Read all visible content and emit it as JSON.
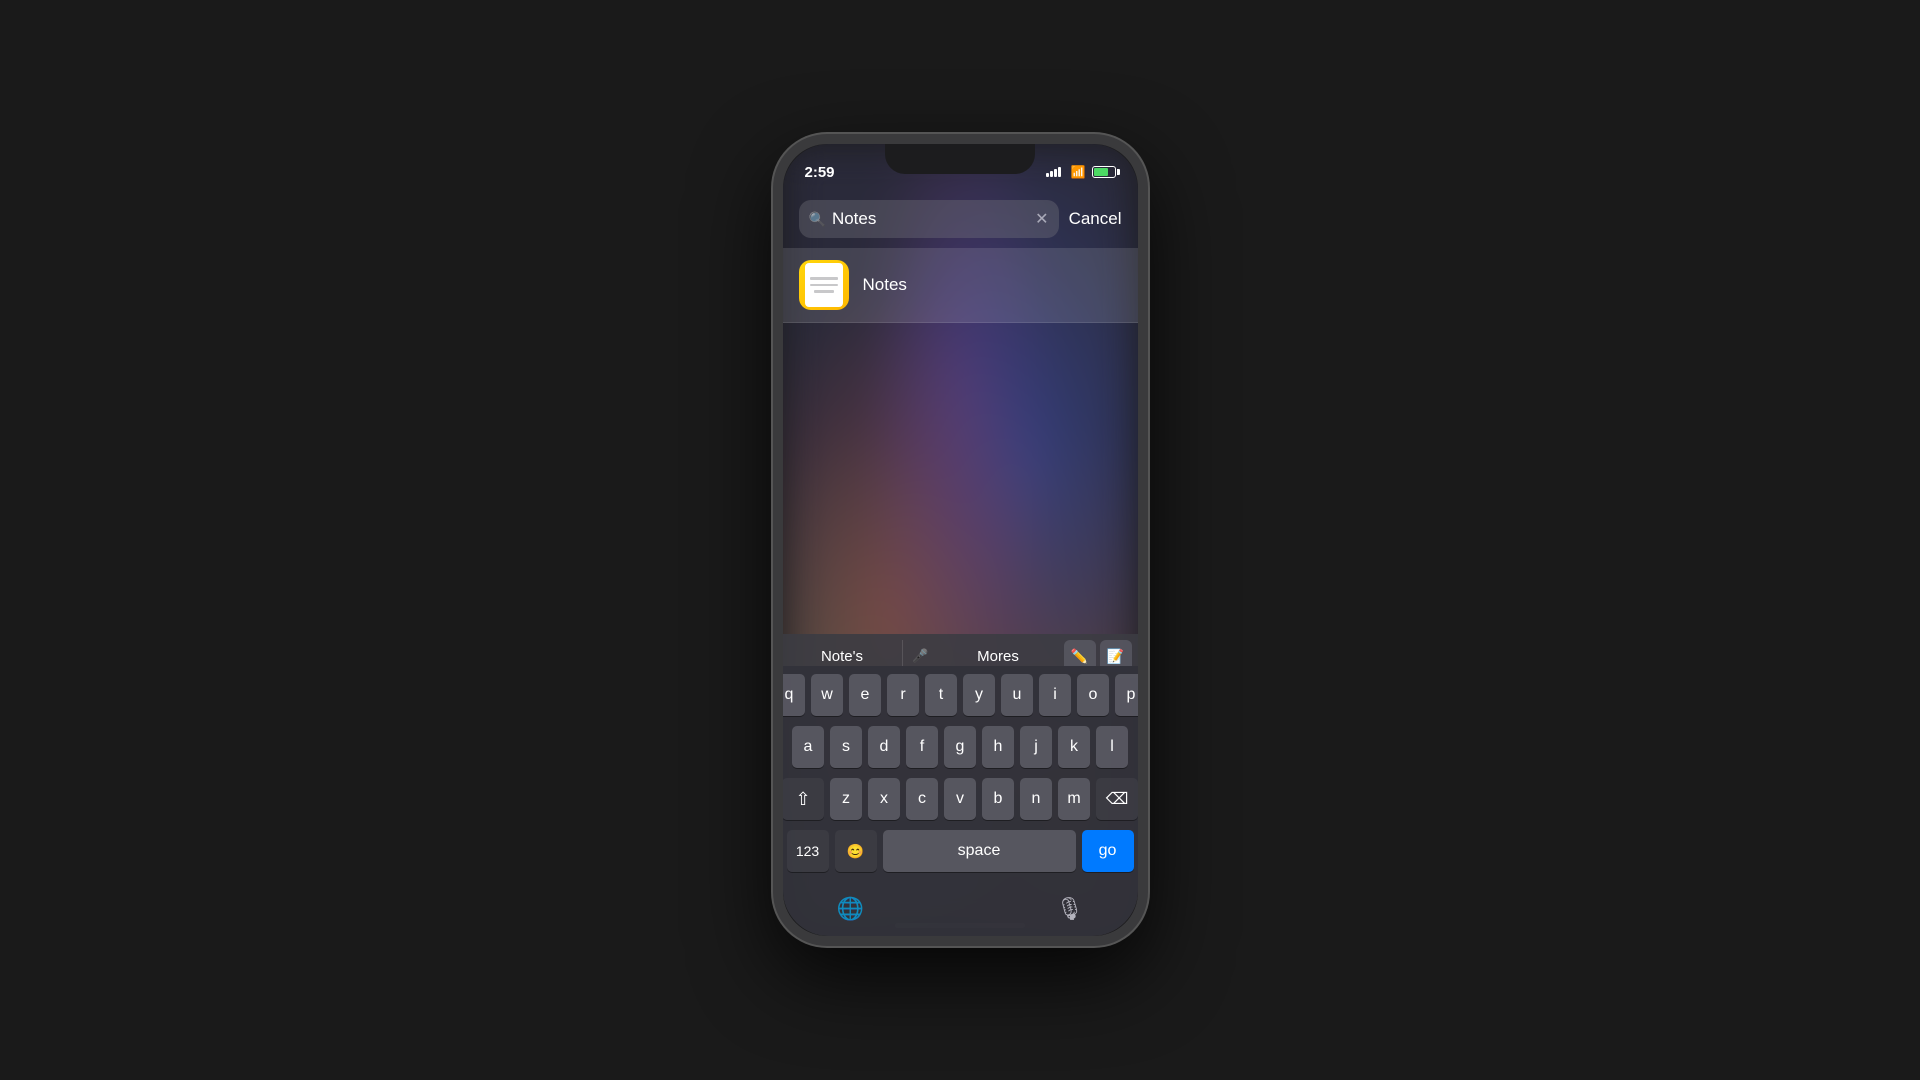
{
  "statusBar": {
    "time": "2:59",
    "signalBars": [
      4,
      6,
      8,
      10,
      12
    ],
    "wifiLabel": "wifi",
    "batteryLabel": "battery"
  },
  "searchBar": {
    "value": "Notes",
    "clearLabel": "✕",
    "cancelLabel": "Cancel"
  },
  "results": [
    {
      "appName": "Notes",
      "iconAlt": "Notes app icon"
    }
  ],
  "keyboard": {
    "suggestions": {
      "word1": "Note's",
      "word2": "Mores",
      "micLabel": "mic",
      "icon1Label": "edit",
      "icon2Label": "edit2"
    },
    "rows": [
      [
        "q",
        "w",
        "e",
        "r",
        "t",
        "y",
        "u",
        "i",
        "o",
        "p"
      ],
      [
        "a",
        "s",
        "d",
        "f",
        "g",
        "h",
        "j",
        "k",
        "l"
      ],
      [
        "z",
        "x",
        "c",
        "v",
        "b",
        "n",
        "m"
      ],
      [
        "123",
        "😊",
        "space",
        "go"
      ]
    ],
    "spaceLabel": "space",
    "goLabel": "go",
    "numberLabel": "123",
    "shiftLabel": "⇧",
    "deleteLabel": "⌫",
    "globeLabel": "🌐",
    "microphoneLabel": "🎙"
  }
}
